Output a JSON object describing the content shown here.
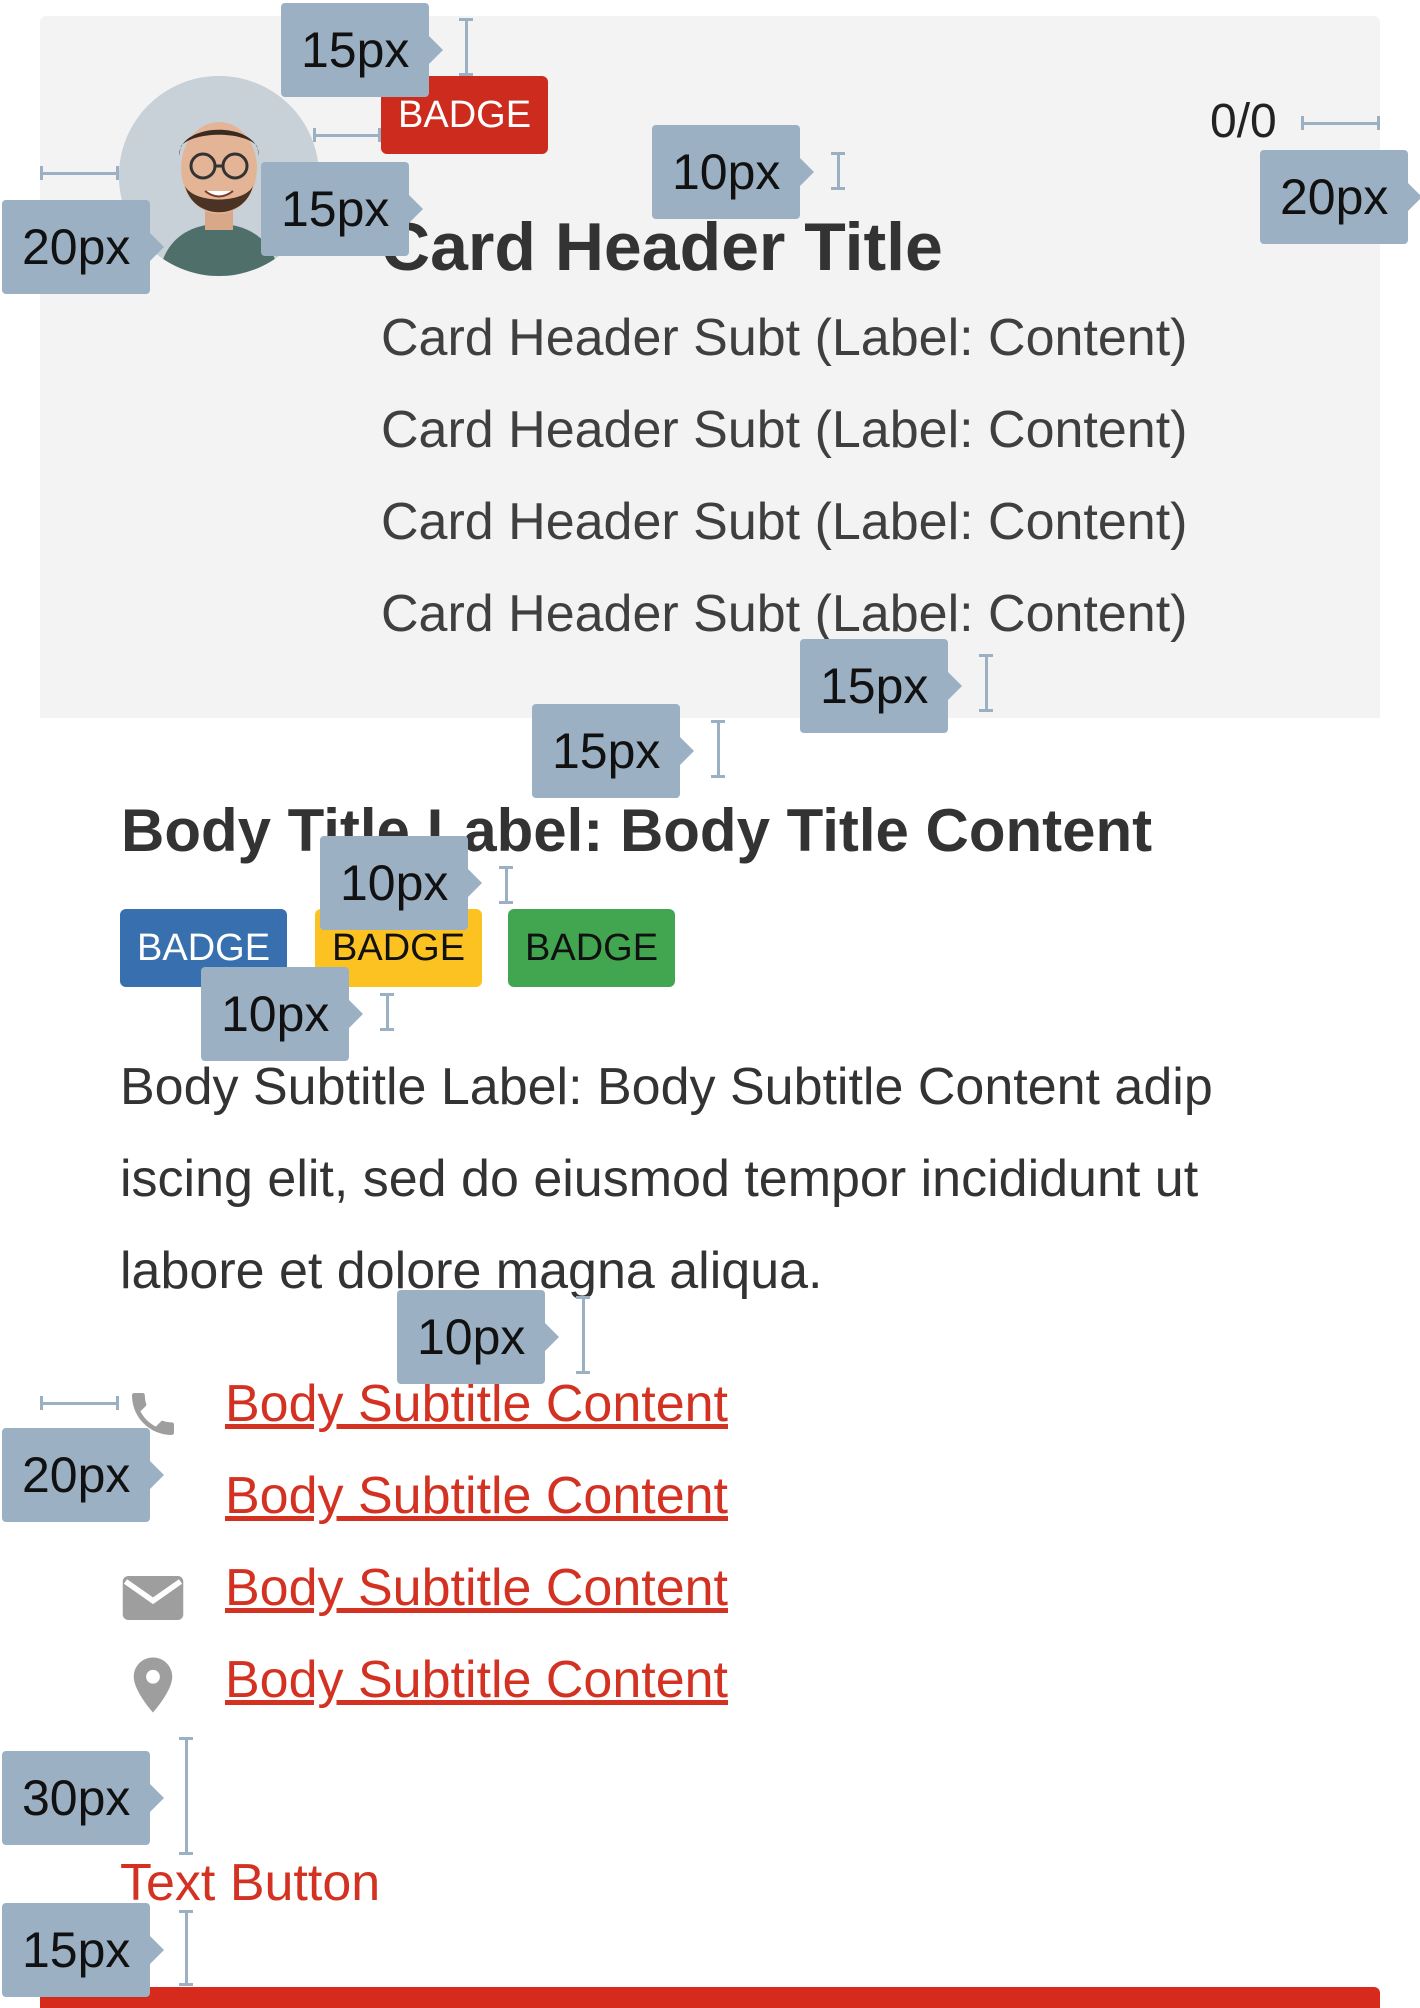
{
  "header": {
    "badge": "BADGE",
    "counter": "0/0",
    "title": "Card Header Title",
    "subtitles": [
      "Card Header Subt (Label: Content)",
      "Card Header Subt (Label: Content)",
      "Card Header Subt (Label: Content)",
      "Card Header Subt (Label: Content)"
    ]
  },
  "body": {
    "title": "Body Title Label: Body Title Content",
    "badges": [
      "BADGE",
      "BADGE",
      "BADGE"
    ],
    "paragraph": "Body Subtitle Label: Body Subtitle Content adip iscing elit, sed do eiusmod tempor incididunt ut labore et dolore magna aliqua.",
    "links": [
      {
        "icon": "phone-icon",
        "label": "Body Subtitle Content"
      },
      {
        "icon": "",
        "label": "Body Subtitle Content"
      },
      {
        "icon": "mail-icon",
        "label": "Body Subtitle Content"
      },
      {
        "icon": "location-pin-icon",
        "label": "Body Subtitle Content"
      }
    ],
    "text_button": "Text Button"
  },
  "annotations": [
    "15px",
    "20px",
    "15px",
    "10px",
    "20px",
    "15px",
    "15px",
    "10px",
    "10px",
    "10px",
    "20px",
    "30px",
    "15px"
  ],
  "colors": {
    "header_bg": "#f3f3f3",
    "brand_red": "#d33222",
    "badge_blue": "#386fae",
    "badge_yellow": "#fbc222",
    "badge_green": "#42a54f",
    "annotation": "#9cb0c3"
  }
}
